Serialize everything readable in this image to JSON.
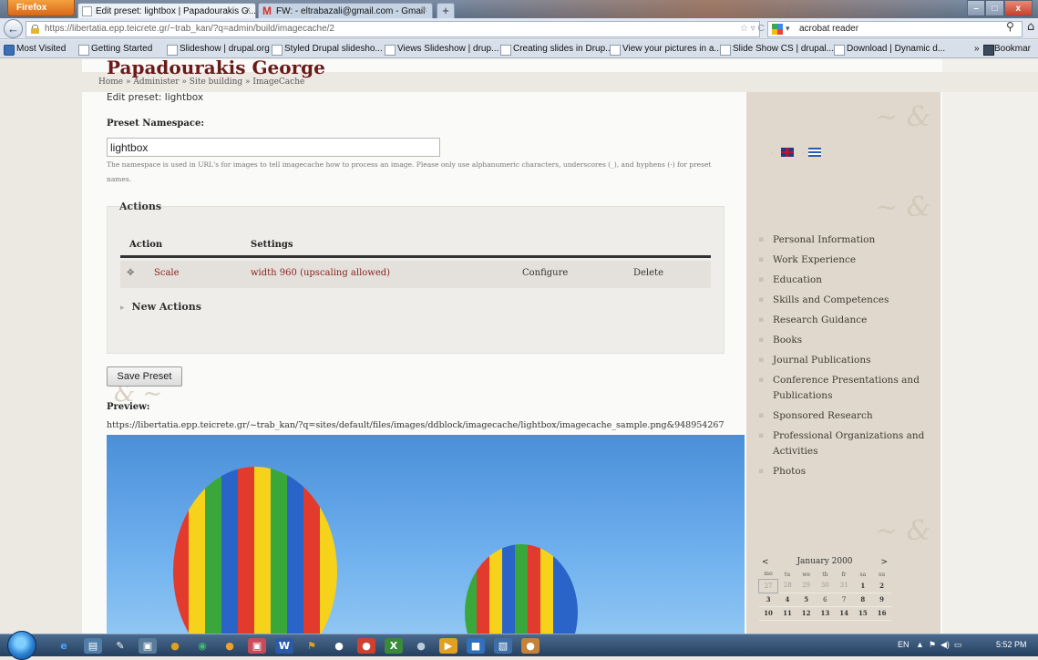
{
  "browser": {
    "app_button": "Firefox",
    "tabs": [
      {
        "title": "Edit preset: lightbox | Papadourakis G..."
      },
      {
        "title": "FW: - eltrabazali@gmail.com - Gmail"
      }
    ],
    "url": "https://libertatia.epp.teicrete.gr/~trab_kan/?q=admin/build/imagecache/2",
    "search_value": "acrobat reader",
    "bookmarks": [
      "Most Visited",
      "Getting Started",
      "Slideshow | drupal.org",
      "Styled Drupal slidesho...",
      "Views Slideshow | drup...",
      "Creating slides in Drup...",
      "View your pictures in a...",
      "Slide Show CS | drupal...",
      "Download | Dynamic d...",
      "Bookmar"
    ]
  },
  "breadcrumb": "Home » Administer » Site building » ImageCache",
  "site_title": "Papadourakis George",
  "subtitle": "Edit preset: lightbox",
  "namespace": {
    "label": "Preset Namespace:",
    "value": "lightbox",
    "description": "The namespace is used in URL's for images to tell imagecache how to process an image. Please only use alphanumeric characters, underscores (_), and hyphens (-) for preset names."
  },
  "actions": {
    "legend": "Actions",
    "headers": {
      "action": "Action",
      "settings": "Settings"
    },
    "row": {
      "action": "Scale",
      "settings": "width 960 (upscaling allowed)",
      "configure": "Configure",
      "delete": "Delete"
    },
    "new_actions": "New Actions"
  },
  "save_button": "Save Preset",
  "preview": {
    "label": "Preview:",
    "url": "https://libertatia.epp.teicrete.gr/~trab_kan/?q=sites/default/files/images/ddblock/imagecache/lightbox/imagecache_sample.png&948954267"
  },
  "sidebar_menu": [
    "Personal Information",
    "Work Experience",
    "Education",
    "Skills and Competences",
    "Research Guidance",
    "Books",
    "Journal Publications",
    "Conference Presentations and Publications",
    "Sponsored Research",
    "Professional Organizations and Activities",
    "Photos"
  ],
  "calendar": {
    "prev": "<",
    "month": "January 2000",
    "next": ">",
    "days": [
      "mo",
      "tu",
      "we",
      "th",
      "fr",
      "sa",
      "su"
    ],
    "weeks": [
      [
        "27",
        "28",
        "29",
        "30",
        "31",
        "1",
        "2"
      ],
      [
        "3",
        "4",
        "5",
        "6",
        "7",
        "8",
        "9"
      ],
      [
        "10",
        "11",
        "12",
        "13",
        "14",
        "15",
        "16"
      ]
    ]
  },
  "taskbar": {
    "lang": "EN",
    "time": "5:52 PM"
  },
  "colors": {
    "title": "#6b1a1a",
    "link_red": "#8b1d1d",
    "sidebar": "#e0d8cc"
  }
}
